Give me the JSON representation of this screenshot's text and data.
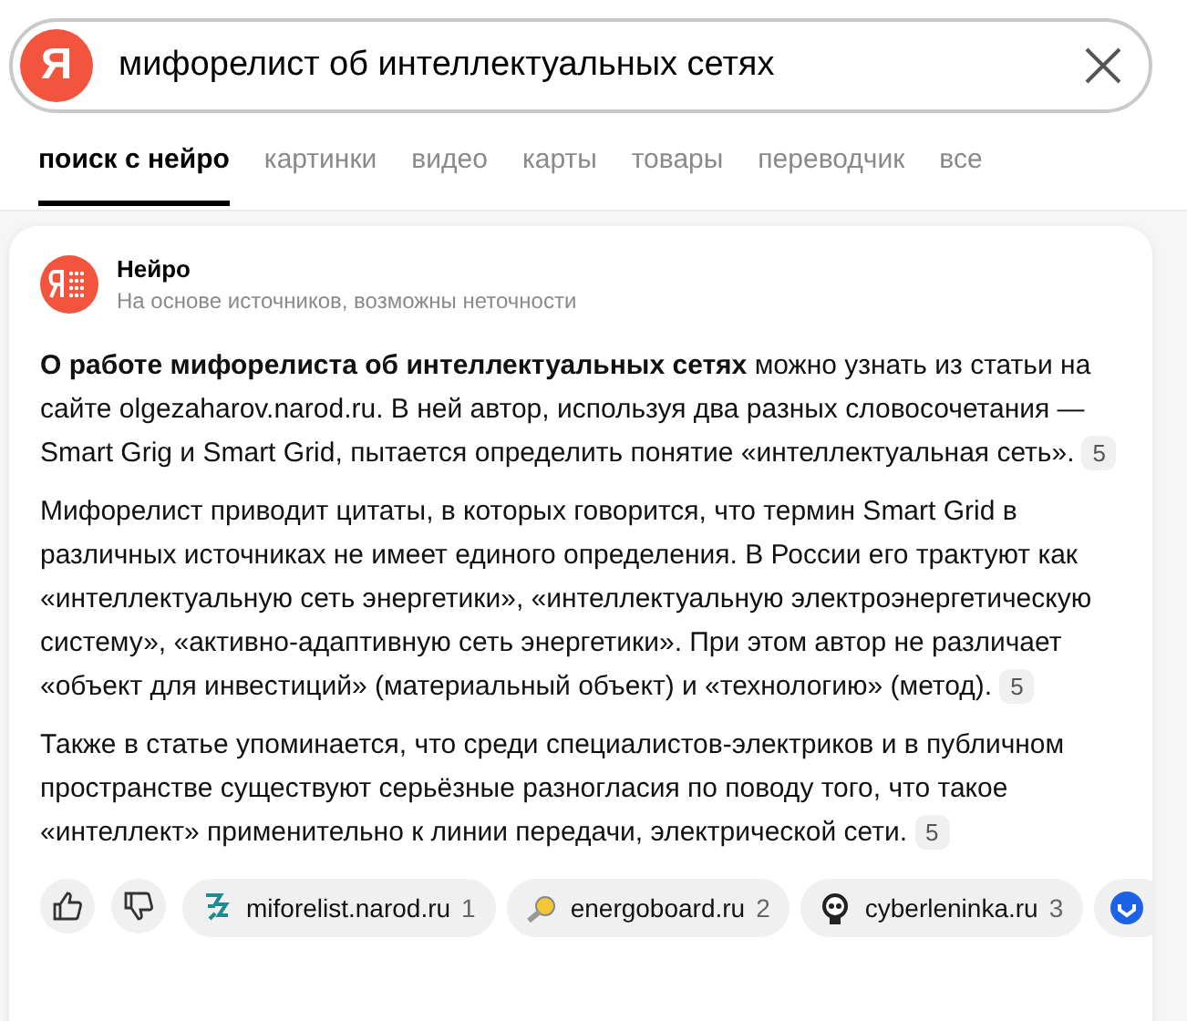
{
  "search": {
    "logo": "Я",
    "value": "мифорелист об интеллектуальных сетях"
  },
  "tabs": [
    {
      "label": "поиск с нейро",
      "selected": true
    },
    {
      "label": "картинки",
      "selected": false
    },
    {
      "label": "видео",
      "selected": false
    },
    {
      "label": "карты",
      "selected": false
    },
    {
      "label": "товары",
      "selected": false
    },
    {
      "label": "переводчик",
      "selected": false
    },
    {
      "label": "все",
      "selected": false
    }
  ],
  "answer": {
    "title": "Нейро",
    "subtitle": "На основе источников, возможны неточности",
    "paragraphs": [
      {
        "text": "**О работе мифорелиста об интеллектуальных сетях** можно узнать из статьи на сайте olgezaharov.narod.ru. В ней автор, используя два разных словосочетания — Smart Grig и Smart Grid, пытается определить понятие «интеллектуальная сеть».",
        "ref": "5"
      },
      {
        "text": "Мифорелист приводит цитаты, в которых говорится, что термин Smart Grid в различных источниках не имеет единого определения. В России его трактуют как «интеллектуальную сеть энергетики», «интеллектуальную электроэнергетическую систему», «активно-адаптивную сеть энергетики». При этом автор не различает «объект для инвестиций» (материальный объект) и «технологию» (метод).",
        "ref": "5"
      },
      {
        "text": "Также в статье упоминается, что среди специалистов-электриков и в публичном пространстве существуют серьёзные разногласия по поводу того, что такое «интеллект» применительно к линии передачи, электрической сети.",
        "ref": "5"
      }
    ],
    "sources": [
      {
        "kind": "figure",
        "name": "miforelist.narod.ru",
        "number": "1"
      },
      {
        "kind": "bulb",
        "name": "energoboard.ru",
        "number": "2"
      },
      {
        "kind": "skull",
        "name": "cyberleninka.ru",
        "number": "3"
      },
      {
        "kind": "shield"
      }
    ]
  }
}
